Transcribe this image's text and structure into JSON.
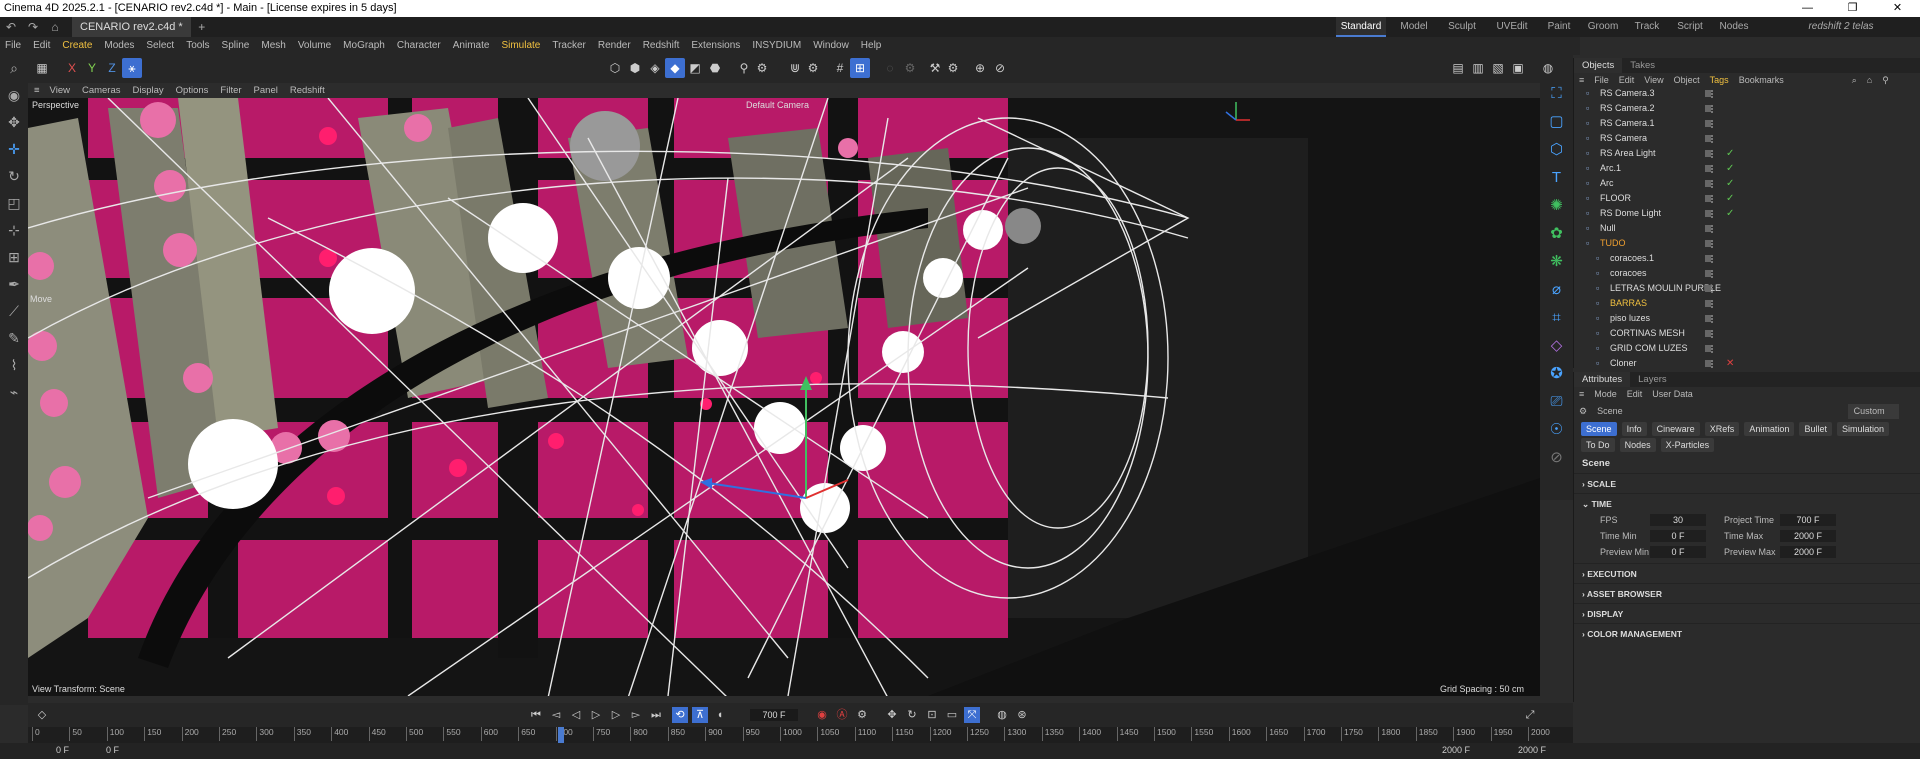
{
  "window": {
    "title": "Cinema 4D 2025.2.1 - [CENARIO rev2.c4d *] - Main - [License expires in 5 days]"
  },
  "document_tab": {
    "label": "CENARIO rev2.c4d *",
    "add_label": "+"
  },
  "layouts": [
    "Standard",
    "Model",
    "Sculpt",
    "UVEdit",
    "Paint",
    "Groom",
    "Track",
    "Script",
    "Nodes",
    "redshift 2 telas"
  ],
  "menu": [
    "File",
    "Edit",
    "Create",
    "Modes",
    "Select",
    "Tools",
    "Spline",
    "Mesh",
    "Volume",
    "MoGraph",
    "Character",
    "Animate",
    "Simulate",
    "Tracker",
    "Render",
    "Redshift",
    "Extensions",
    "INSYDIUM",
    "Window",
    "Help"
  ],
  "axis_toggles": [
    "X",
    "Y",
    "Z"
  ],
  "viewport": {
    "menu": [
      "View",
      "Cameras",
      "Display",
      "Options",
      "Filter",
      "Panel",
      "Redshift"
    ],
    "projection": "Perspective",
    "camera": "Default Camera",
    "mode_label": "Move",
    "view_transform": "View Transform: Scene",
    "grid_spacing": "Grid Spacing : 50 cm"
  },
  "objects_panel": {
    "tabs": [
      "Objects",
      "Takes"
    ],
    "menu": [
      "File",
      "Edit",
      "View",
      "Object",
      "Tags",
      "Bookmarks"
    ],
    "items": [
      {
        "name": "RS Camera.3",
        "state": "none"
      },
      {
        "name": "RS Camera.2",
        "state": "none"
      },
      {
        "name": "RS Camera.1",
        "state": "none"
      },
      {
        "name": "RS Camera",
        "state": "none"
      },
      {
        "name": "RS Area Light",
        "state": "check"
      },
      {
        "name": "Arc.1",
        "state": "check"
      },
      {
        "name": "Arc",
        "state": "check"
      },
      {
        "name": "FLOOR",
        "state": "check"
      },
      {
        "name": "RS Dome Light",
        "state": "check"
      },
      {
        "name": "Null",
        "state": "none"
      },
      {
        "name": "TUDO",
        "state": "none"
      },
      {
        "name": "coracoes.1",
        "state": "none"
      },
      {
        "name": "coracoes",
        "state": "none"
      },
      {
        "name": "LETRAS MOULIN PURPLE",
        "state": "none"
      },
      {
        "name": "BARRAS",
        "state": "none"
      },
      {
        "name": "piso luzes",
        "state": "none"
      },
      {
        "name": "CORTINAS MESH",
        "state": "none"
      },
      {
        "name": "GRID COM LUZES",
        "state": "none"
      },
      {
        "name": "Cloner",
        "state": "cross"
      }
    ]
  },
  "attributes_panel": {
    "tabs": [
      "Attributes",
      "Layers"
    ],
    "menu": [
      "Mode",
      "Edit",
      "User Data"
    ],
    "object_name": "Scene",
    "preset": "Custom",
    "subtabs": [
      "Scene",
      "Info",
      "Cineware",
      "XRefs",
      "Animation",
      "Bullet",
      "Simulation",
      "To Do",
      "Nodes",
      "X-Particles"
    ],
    "heading": "Scene",
    "sections": [
      "SCALE",
      "TIME",
      "EXECUTION",
      "ASSET BROWSER",
      "DISPLAY",
      "COLOR MANAGEMENT"
    ],
    "time": {
      "fps_label": "FPS",
      "fps": "30",
      "project_time_label": "Project Time",
      "project_time": "700 F",
      "time_min_label": "Time Min",
      "time_min": "0 F",
      "time_max_label": "Time Max",
      "time_max": "2000 F",
      "preview_min_label": "Preview Min",
      "preview_min": "0 F",
      "preview_max_label": "Preview Max",
      "preview_max": "2000 F"
    }
  },
  "timeline": {
    "current_frame": "700 F",
    "ticks": [
      "0",
      "50",
      "100",
      "150",
      "200",
      "250",
      "300",
      "350",
      "400",
      "450",
      "500",
      "550",
      "600",
      "650",
      "700",
      "750",
      "800",
      "850",
      "900",
      "950",
      "1000",
      "1050",
      "1100",
      "1150",
      "1200",
      "1250",
      "1300",
      "1350",
      "1400",
      "1450",
      "1500",
      "1550",
      "1600",
      "1650",
      "1700",
      "1750",
      "1800",
      "1850",
      "1900",
      "1950",
      "2000"
    ],
    "playhead_label": "700"
  },
  "status": {
    "start_a": "0 F",
    "start_b": "0 F",
    "end_a": "2000 F",
    "end_b": "2000 F"
  },
  "colors": {
    "accent": "#3d6fd1",
    "pink": "#d8207a",
    "check": "#5ec452",
    "null_orange": "#f0a030"
  }
}
